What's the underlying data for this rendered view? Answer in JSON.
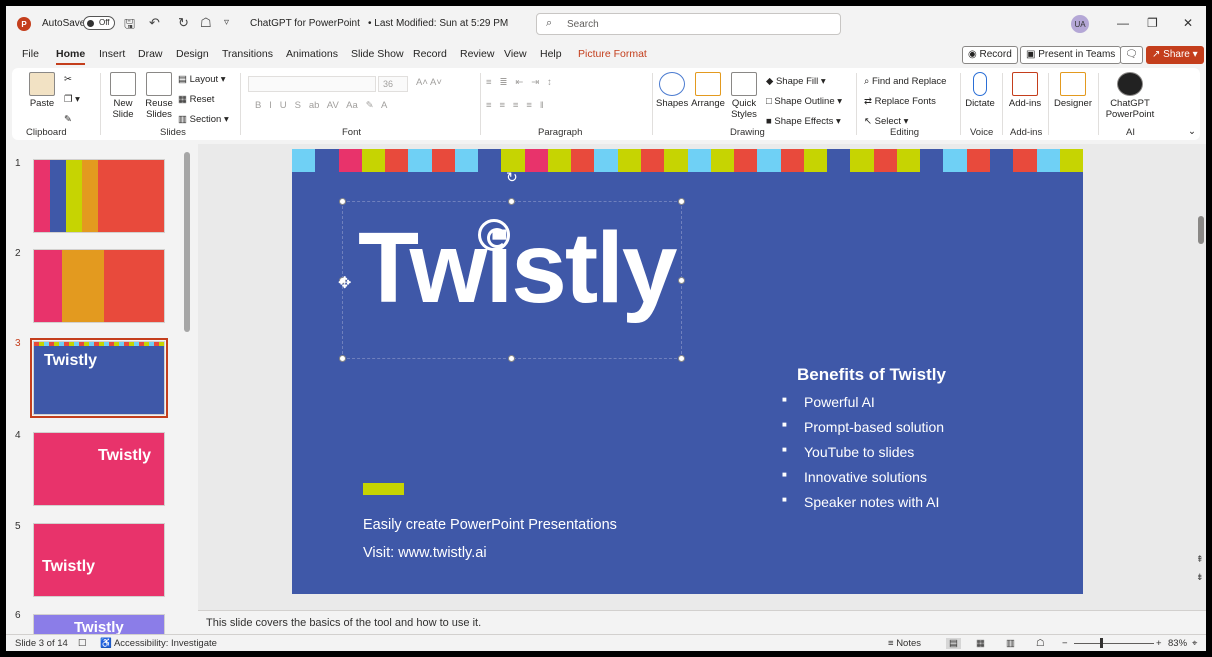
{
  "app": {
    "autosave_label": "AutoSave",
    "autosave_state": "Off",
    "doc_title": "ChatGPT for PowerPoint",
    "modified": "• Last Modified: Sun at 5:29 PM",
    "search_placeholder": "Search",
    "avatar_initials": "UA"
  },
  "menu": {
    "tabs": [
      "File",
      "Home",
      "Insert",
      "Draw",
      "Design",
      "Transitions",
      "Animations",
      "Slide Show",
      "Record",
      "Review",
      "View",
      "Help",
      "Picture Format"
    ],
    "record_button": "Record",
    "present_teams": "Present in Teams",
    "share": "Share"
  },
  "ribbon": {
    "clipboard": {
      "paste": "Paste",
      "label": "Clipboard"
    },
    "slides": {
      "new_slide": "New Slide",
      "reuse_slides": "Reuse Slides",
      "layout": "Layout",
      "reset": "Reset",
      "section": "Section",
      "label": "Slides"
    },
    "font": {
      "label": "Font",
      "size": "36"
    },
    "paragraph": {
      "label": "Paragraph"
    },
    "drawing": {
      "shapes": "Shapes",
      "arrange": "Arrange",
      "quick_styles": "Quick Styles",
      "shape_fill": "Shape Fill",
      "shape_outline": "Shape Outline",
      "shape_effects": "Shape Effects",
      "label": "Drawing"
    },
    "editing": {
      "find_replace": "Find and Replace",
      "replace_fonts": "Replace Fonts",
      "select": "Select",
      "label": "Editing"
    },
    "voice": {
      "dictate": "Dictate",
      "label": "Voice"
    },
    "addins": {
      "addins": "Add-ins",
      "label": "Add-ins"
    },
    "designer": {
      "designer": "Designer"
    },
    "ai": {
      "chatgpt": "ChatGPT PowerPoint",
      "label": "AI"
    }
  },
  "thumbnails": {
    "numbers": [
      "1",
      "2",
      "3",
      "4",
      "5",
      "6"
    ]
  },
  "slide": {
    "logo": "Twistly",
    "tagline": "Easily create PowerPoint Presentations",
    "visit": "Visit: www.twistly.ai",
    "benefits_title": "Benefits of Twistly",
    "benefits": [
      "Powerful AI",
      "Prompt-based solution",
      "YouTube to slides",
      "Innovative solutions",
      "Speaker notes with AI"
    ],
    "bunting_colors": [
      "#6fd0f5",
      "#3f58a8",
      "#e8336b",
      "#c6d402",
      "#e84a3c",
      "#6fd0f5",
      "#e84a3c",
      "#6fd0f5",
      "#3f58a8",
      "#c6d402",
      "#e8336b",
      "#c6d402",
      "#e84a3c",
      "#6fd0f5",
      "#c6d402",
      "#e84a3c",
      "#c6d402",
      "#6fd0f5",
      "#c6d402",
      "#e84a3c",
      "#6fd0f5",
      "#e84a3c",
      "#c6d402",
      "#3f58a8",
      "#c6d402",
      "#e84a3c",
      "#c6d402",
      "#3f58a8",
      "#6fd0f5",
      "#e84a3c",
      "#3f58a8",
      "#e84a3c",
      "#6fd0f5",
      "#c6d402"
    ]
  },
  "notes": "This slide covers the basics of the tool and how to use it.",
  "status": {
    "slide_of": "Slide 3 of 14",
    "accessibility": "Accessibility: Investigate",
    "notes_button": "Notes",
    "zoom": "83%"
  }
}
